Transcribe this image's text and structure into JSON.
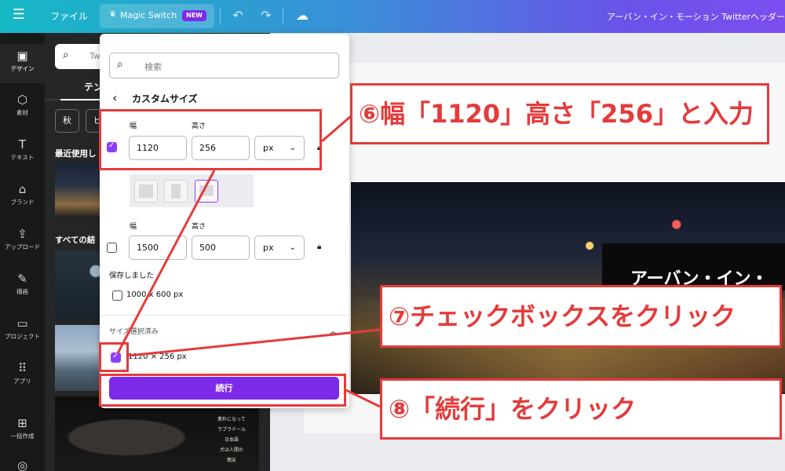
{
  "topbar": {
    "file_label": "ファイル",
    "magic_switch_label": "Magic Switch",
    "magic_switch_badge": "NEW",
    "document_title": "アーバン・イン・モーション Twitterヘッダー"
  },
  "rail": {
    "items": [
      {
        "label": "デザイン",
        "icon": "layout-icon"
      },
      {
        "label": "素材",
        "icon": "shapes-icon"
      },
      {
        "label": "テキスト",
        "icon": "text-icon"
      },
      {
        "label": "ブランド",
        "icon": "brand-icon"
      },
      {
        "label": "アップロード",
        "icon": "upload-icon"
      },
      {
        "label": "描画",
        "icon": "draw-icon"
      },
      {
        "label": "プロジェクト",
        "icon": "folder-icon"
      },
      {
        "label": "アプリ",
        "icon": "apps-icon"
      },
      {
        "label": "一括作成",
        "icon": "bulk-create-icon"
      }
    ]
  },
  "sidepanel": {
    "search_text": "Twitt",
    "tab_label": "テン",
    "chips": [
      "秋",
      "ビ"
    ],
    "recent_label": "最近使用し",
    "all_results_label": "すべての結",
    "dog_thumb_text": [
      "素朴になって",
      "ラブラドール",
      "日本語",
      "犬は人間の",
      "親友"
    ]
  },
  "canvas": {
    "title_text": "アーバン・イン・"
  },
  "resize_popup": {
    "search_placeholder": "検索",
    "heading": "カスタムサイズ",
    "custom": {
      "width_label": "幅",
      "height_label": "高さ",
      "width_value": "1120",
      "height_value": "256",
      "unit": "px",
      "checked": true
    },
    "original": {
      "width_label": "幅",
      "height_label": "高さ",
      "width_value": "1500",
      "height_value": "500",
      "unit": "px",
      "checked": false
    },
    "saved_label": "保存しました",
    "saved_item": "1000 x 600 px",
    "selected_label": "サイズ選択済み",
    "selected_item": "1120 × 256 px",
    "continue_label": "続行"
  },
  "annotations": {
    "step6": "⑥幅「1120」高さ「256」と入力",
    "step7": "⑦チェックボックスをクリック",
    "step8": "⑧「続行」をクリック",
    "color": "#e43b3b"
  },
  "colors": {
    "accent_purple": "#8b3dff",
    "button_purple": "#7d2ae8",
    "rail_bg": "#18191b"
  }
}
